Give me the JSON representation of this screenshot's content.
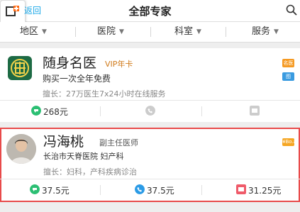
{
  "header": {
    "back_label": "返回",
    "title": "全部专家"
  },
  "filters": [
    {
      "label": "地区"
    },
    {
      "label": "医院"
    },
    {
      "label": "科室"
    },
    {
      "label": "服务"
    }
  ],
  "cards": [
    {
      "name": "随身名医",
      "badge": "VIP年卡",
      "subtitle": "购买一次全年免费",
      "specialty": "擅长：27万医生7x24小时在线服务",
      "tags": [
        "名医",
        "图"
      ],
      "services": [
        {
          "icon": "chat-icon",
          "price": "268元",
          "color": "#2bbf73"
        },
        {
          "icon": "phone-icon",
          "price": "",
          "color": "#cccccc"
        },
        {
          "icon": "clinic-icon",
          "price": "",
          "color": "#cccccc"
        }
      ]
    },
    {
      "name": "冯海桃",
      "title": "副主任医师",
      "hospital": "长治市天脊医院 妇产科",
      "specialty": "擅长：妇科，产科疾病诊治",
      "tag": "¥Bo.ai",
      "services": [
        {
          "icon": "chat-icon",
          "price": "37.5元",
          "color": "#2bbf73"
        },
        {
          "icon": "phone-icon",
          "price": "37.5元",
          "color": "#2b9be6"
        },
        {
          "icon": "clinic-icon",
          "price": "31.25元",
          "color": "#ef5b6a"
        }
      ]
    }
  ]
}
